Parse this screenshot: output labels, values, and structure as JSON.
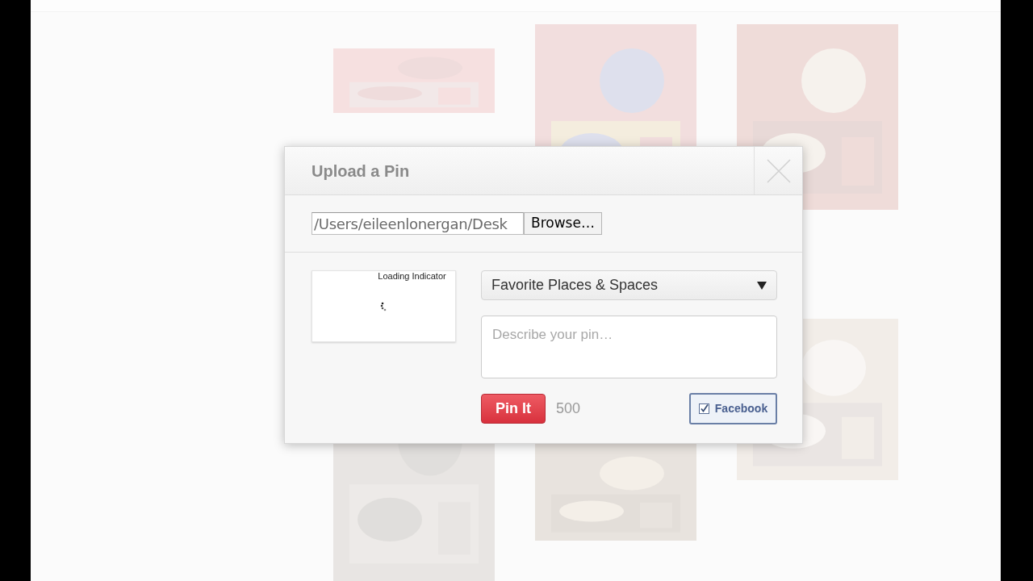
{
  "dialog": {
    "title": "Upload a Pin",
    "file_path": "/Users/eileenlonergan/Desk",
    "browse_button": "Browse…",
    "preview_label": "Loading Indicator",
    "board_select": {
      "value": "Favorite Places & Spaces"
    },
    "description": {
      "placeholder": "Describe your pin…"
    },
    "pin_button": "Pin It",
    "char_count": "500",
    "share": {
      "label": "Facebook",
      "checked": true
    }
  }
}
